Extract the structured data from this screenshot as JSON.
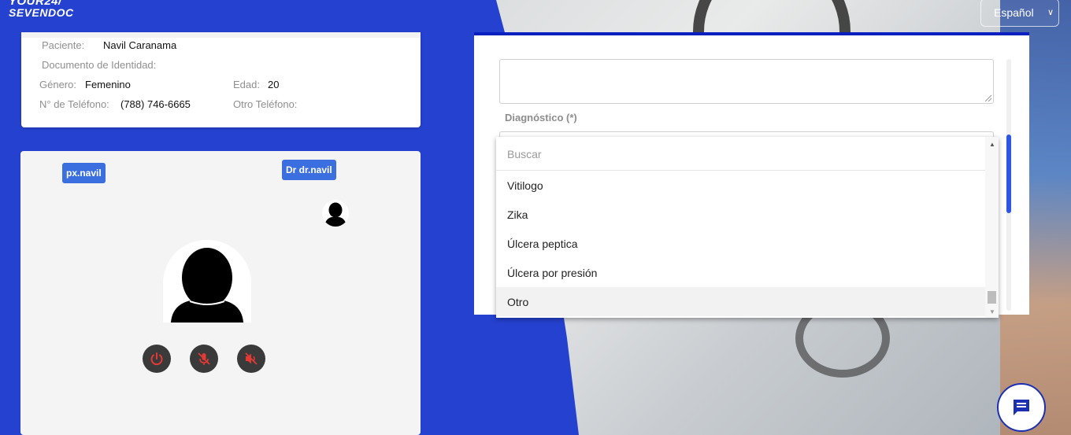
{
  "logo": {
    "line1": "YOUR24/",
    "line2": "SEVENDOC"
  },
  "language": {
    "selected": "Español"
  },
  "patient": {
    "name_label": "Paciente:",
    "name_value": "Navil Caranama",
    "id_label": "Documento de Identidad:",
    "gender_label": "Género:",
    "gender_value": "Femenino",
    "age_label": "Edad:",
    "age_value": "20",
    "phone_label": "N° de Teléfono:",
    "phone_value": "(788) 746-6665",
    "other_phone_label": "Otro Teléfono:"
  },
  "video": {
    "patient_tag": "px.navil",
    "doctor_tag": "Dr dr.navil"
  },
  "form": {
    "diagnosis_label": "Diagnóstico (*)"
  },
  "dropdown": {
    "search_placeholder": "Buscar",
    "items": [
      "Vitilogo",
      "Zika",
      "Úlcera peptica",
      "Úlcera por presión",
      "Otro"
    ],
    "highlighted": "Otro"
  },
  "colors": {
    "brand_blue": "#2541d0",
    "tag_blue": "#3b6fe0",
    "danger_red": "#e53935"
  },
  "icons": {
    "end_call": "power-icon",
    "mic": "mic-off-icon",
    "speaker": "volume-off-icon",
    "chat": "chat-icon"
  }
}
